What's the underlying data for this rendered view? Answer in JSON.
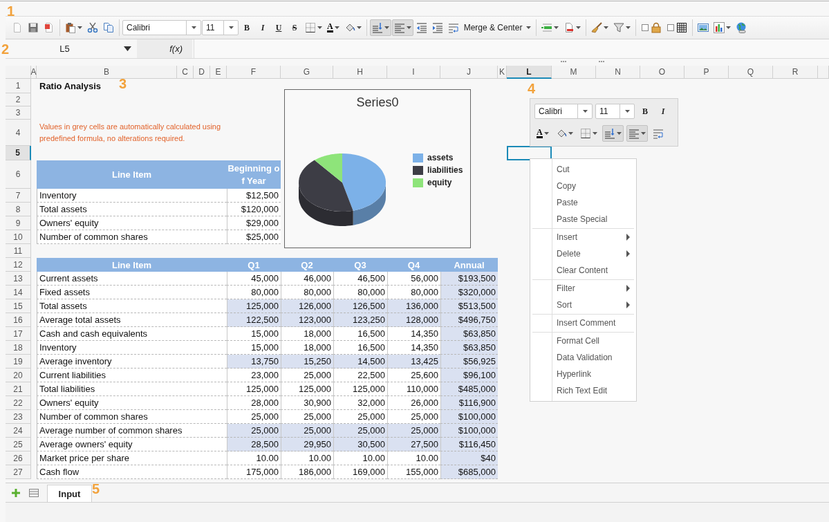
{
  "callouts": [
    {
      "label": "1"
    },
    {
      "label": "2"
    },
    {
      "label": "3"
    },
    {
      "label": "4"
    },
    {
      "label": "5"
    }
  ],
  "toolbar": {
    "font_name": "Calibri",
    "font_size": "11",
    "format_buttons": [
      {
        "kind": "bold",
        "label": "B"
      },
      {
        "kind": "italic",
        "label": "I"
      },
      {
        "kind": "underline",
        "label": "U"
      },
      {
        "kind": "strike",
        "label": "S"
      }
    ],
    "font_color_label": "A",
    "align_buttons": [
      {
        "kind": "valign",
        "pressed": true
      },
      {
        "kind": "align",
        "pressed": true
      },
      {
        "kind": "outdent",
        "pressed": false
      },
      {
        "kind": "indent",
        "pressed": false
      },
      {
        "kind": "wrap",
        "pressed": false
      }
    ],
    "merge_label": "Merge & Center"
  },
  "formula_bar": {
    "cell_reference": "L5",
    "function_label": "f(x)"
  },
  "sheet": {
    "columns": [
      {
        "label": "A",
        "selected": false
      },
      {
        "label": "B",
        "selected": false
      },
      {
        "label": "C",
        "selected": false
      },
      {
        "label": "D",
        "selected": false
      },
      {
        "label": "E",
        "selected": false
      },
      {
        "label": "F",
        "selected": false
      },
      {
        "label": "G",
        "selected": false
      },
      {
        "label": "H",
        "selected": false
      },
      {
        "label": "I",
        "selected": false
      },
      {
        "label": "J",
        "selected": false
      },
      {
        "label": "K",
        "selected": false
      },
      {
        "label": "L",
        "selected": true
      },
      {
        "label": "M",
        "selected": false
      },
      {
        "label": "N",
        "selected": false
      },
      {
        "label": "O",
        "selected": false
      },
      {
        "label": "P",
        "selected": false
      },
      {
        "label": "Q",
        "selected": false
      },
      {
        "label": "R",
        "selected": false
      }
    ],
    "rows": [
      {
        "label": "1",
        "selected": false
      },
      {
        "label": "2",
        "selected": false
      },
      {
        "label": "3",
        "selected": false
      },
      {
        "label": "4",
        "selected": false
      },
      {
        "label": "5",
        "selected": true
      },
      {
        "label": "6",
        "selected": false
      },
      {
        "label": "7",
        "selected": false
      },
      {
        "label": "8",
        "selected": false
      },
      {
        "label": "9",
        "selected": false
      },
      {
        "label": "10",
        "selected": false
      },
      {
        "label": "11",
        "selected": false
      },
      {
        "label": "12",
        "selected": false
      },
      {
        "label": "13",
        "selected": false
      },
      {
        "label": "14",
        "selected": false
      },
      {
        "label": "15",
        "selected": false
      },
      {
        "label": "16",
        "selected": false
      },
      {
        "label": "17",
        "selected": false
      },
      {
        "label": "18",
        "selected": false
      },
      {
        "label": "19",
        "selected": false
      },
      {
        "label": "20",
        "selected": false
      },
      {
        "label": "21",
        "selected": false
      },
      {
        "label": "22",
        "selected": false
      },
      {
        "label": "23",
        "selected": false
      },
      {
        "label": "24",
        "selected": false
      },
      {
        "label": "25",
        "selected": false
      },
      {
        "label": "26",
        "selected": false
      },
      {
        "label": "27",
        "selected": false
      }
    ],
    "title": "Ratio Analysis",
    "note": "Values in grey cells are automatically calculated using predefined formula, no alterations required.",
    "opening_table": {
      "columns": [
        "Line Item",
        "Beginning of Year"
      ],
      "rows": [
        {
          "item": "Inventory",
          "value": "$12,500"
        },
        {
          "item": "Total assets",
          "value": "$120,000"
        },
        {
          "item": "Owners' equity",
          "value": "$29,000"
        },
        {
          "item": "Number of common shares",
          "value": "$25,000"
        }
      ]
    },
    "quarterly_table": {
      "columns": [
        "Line Item",
        "Q1",
        "Q2",
        "Q3",
        "Q4",
        "Annual"
      ],
      "annual_calculated": true,
      "rows": [
        {
          "item": "Current assets",
          "values": [
            "45,000",
            "46,000",
            "46,500",
            "56,000"
          ],
          "annual": "$193,500",
          "calculated": false
        },
        {
          "item": "Fixed assets",
          "values": [
            "80,000",
            "80,000",
            "80,000",
            "80,000"
          ],
          "annual": "$320,000",
          "calculated": false
        },
        {
          "item": "Total assets",
          "values": [
            "125,000",
            "126,000",
            "126,500",
            "136,000"
          ],
          "annual": "$513,500",
          "calculated": true
        },
        {
          "item": "Average total assets",
          "values": [
            "122,500",
            "123,000",
            "123,250",
            "128,000"
          ],
          "annual": "$496,750",
          "calculated": true
        },
        {
          "item": "Cash and cash equivalents",
          "values": [
            "15,000",
            "18,000",
            "16,500",
            "14,350"
          ],
          "annual": "$63,850",
          "calculated": false
        },
        {
          "item": "Inventory",
          "values": [
            "15,000",
            "18,000",
            "16,500",
            "14,350"
          ],
          "annual": "$63,850",
          "calculated": false
        },
        {
          "item": "Average inventory",
          "values": [
            "13,750",
            "15,250",
            "14,500",
            "13,425"
          ],
          "annual": "$56,925",
          "calculated": true
        },
        {
          "item": "Current liabilities",
          "values": [
            "23,000",
            "25,000",
            "22,500",
            "25,600"
          ],
          "annual": "$96,100",
          "calculated": false
        },
        {
          "item": "Total liabilities",
          "values": [
            "125,000",
            "125,000",
            "125,000",
            "110,000"
          ],
          "annual": "$485,000",
          "calculated": false
        },
        {
          "item": "Owners' equity",
          "values": [
            "28,000",
            "30,900",
            "32,000",
            "26,000"
          ],
          "annual": "$116,900",
          "calculated": false
        },
        {
          "item": "Number of common shares",
          "values": [
            "25,000",
            "25,000",
            "25,000",
            "25,000"
          ],
          "annual": "$100,000",
          "calculated": false
        },
        {
          "item": "Average number of common shares",
          "values": [
            "25,000",
            "25,000",
            "25,000",
            "25,000"
          ],
          "annual": "$100,000",
          "calculated": true
        },
        {
          "item": "Average owners' equity",
          "values": [
            "28,500",
            "29,950",
            "30,500",
            "27,500"
          ],
          "annual": "$116,450",
          "calculated": true
        },
        {
          "item": "Market price per share",
          "values": [
            "10.00",
            "10.00",
            "10.00",
            "10.00"
          ],
          "annual": "$40",
          "calculated": false
        },
        {
          "item": "Cash flow",
          "values": [
            "175,000",
            "186,000",
            "169,000",
            "155,000"
          ],
          "annual": "$685,000",
          "calculated": false
        }
      ]
    },
    "chart": {
      "title": "Series0",
      "legend": [
        {
          "label": "assets",
          "color": "#7cb1e8"
        },
        {
          "label": "liabilities",
          "color": "#3d3d45"
        },
        {
          "label": "equity",
          "color": "#8ee47a"
        }
      ]
    },
    "mini_toolbar": {
      "font_name": "Calibri",
      "font_size": "11",
      "format_buttons": [
        {
          "kind": "bold",
          "label": "B"
        },
        {
          "kind": "italic",
          "label": "I"
        }
      ],
      "font_color_label": "A",
      "align_buttons": [
        {
          "kind": "valign",
          "pressed": true
        },
        {
          "kind": "align",
          "pressed": true
        },
        {
          "kind": "wrap",
          "pressed": false
        }
      ]
    },
    "context_menu": [
      {
        "kind": "item",
        "label": "Cut",
        "submenu": false
      },
      {
        "kind": "item",
        "label": "Copy",
        "submenu": false
      },
      {
        "kind": "item",
        "label": "Paste",
        "submenu": false
      },
      {
        "kind": "item",
        "label": "Paste Special",
        "submenu": false
      },
      {
        "kind": "separator"
      },
      {
        "kind": "item",
        "label": "Insert",
        "submenu": true
      },
      {
        "kind": "item",
        "label": "Delete",
        "submenu": true
      },
      {
        "kind": "item",
        "label": "Clear Content",
        "submenu": false
      },
      {
        "kind": "separator"
      },
      {
        "kind": "item",
        "label": "Filter",
        "submenu": true
      },
      {
        "kind": "item",
        "label": "Sort",
        "submenu": true
      },
      {
        "kind": "separator"
      },
      {
        "kind": "item",
        "label": "Insert Comment",
        "submenu": false
      },
      {
        "kind": "separator"
      },
      {
        "kind": "item",
        "label": "Format Cell",
        "submenu": false
      },
      {
        "kind": "item",
        "label": "Data Validation",
        "submenu": false
      },
      {
        "kind": "item",
        "label": "Hyperlink",
        "submenu": false
      },
      {
        "kind": "item",
        "label": "Rich Text Edit",
        "submenu": false
      }
    ]
  },
  "sheet_tabs": [
    {
      "label": "Input",
      "selected": true
    }
  ]
}
